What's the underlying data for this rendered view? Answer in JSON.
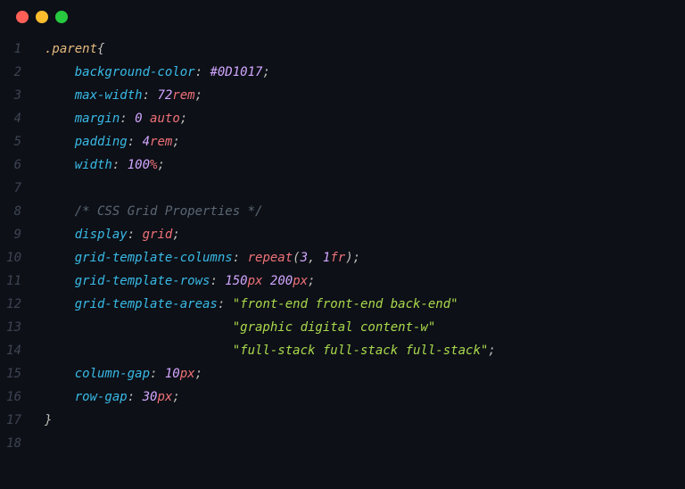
{
  "trafficLights": [
    "red",
    "yellow",
    "green"
  ],
  "lines": [
    {
      "n": 1,
      "tokens": [
        {
          "t": ".parent",
          "c": "selector"
        },
        {
          "t": "{",
          "c": "punc"
        }
      ]
    },
    {
      "n": 2,
      "tokens": [
        {
          "t": "    ",
          "c": "punc"
        },
        {
          "t": "background-color",
          "c": "prop"
        },
        {
          "t": ": ",
          "c": "punc"
        },
        {
          "t": "#0D1017",
          "c": "number"
        },
        {
          "t": ";",
          "c": "punc"
        }
      ]
    },
    {
      "n": 3,
      "tokens": [
        {
          "t": "    ",
          "c": "punc"
        },
        {
          "t": "max-width",
          "c": "prop"
        },
        {
          "t": ": ",
          "c": "punc"
        },
        {
          "t": "72",
          "c": "number"
        },
        {
          "t": "rem",
          "c": "unit"
        },
        {
          "t": ";",
          "c": "punc"
        }
      ]
    },
    {
      "n": 4,
      "tokens": [
        {
          "t": "    ",
          "c": "punc"
        },
        {
          "t": "margin",
          "c": "prop"
        },
        {
          "t": ": ",
          "c": "punc"
        },
        {
          "t": "0",
          "c": "number"
        },
        {
          "t": " ",
          "c": "punc"
        },
        {
          "t": "auto",
          "c": "value-ident"
        },
        {
          "t": ";",
          "c": "punc"
        }
      ]
    },
    {
      "n": 5,
      "tokens": [
        {
          "t": "    ",
          "c": "punc"
        },
        {
          "t": "padding",
          "c": "prop"
        },
        {
          "t": ": ",
          "c": "punc"
        },
        {
          "t": "4",
          "c": "number"
        },
        {
          "t": "rem",
          "c": "unit"
        },
        {
          "t": ";",
          "c": "punc"
        }
      ]
    },
    {
      "n": 6,
      "tokens": [
        {
          "t": "    ",
          "c": "punc"
        },
        {
          "t": "width",
          "c": "prop"
        },
        {
          "t": ": ",
          "c": "punc"
        },
        {
          "t": "100",
          "c": "number"
        },
        {
          "t": "%",
          "c": "unit upright"
        },
        {
          "t": ";",
          "c": "punc"
        }
      ]
    },
    {
      "n": 7,
      "tokens": []
    },
    {
      "n": 8,
      "tokens": [
        {
          "t": "    ",
          "c": "punc"
        },
        {
          "t": "/* CSS Grid Properties */",
          "c": "comment"
        }
      ]
    },
    {
      "n": 9,
      "tokens": [
        {
          "t": "    ",
          "c": "punc"
        },
        {
          "t": "display",
          "c": "prop"
        },
        {
          "t": ": ",
          "c": "punc"
        },
        {
          "t": "grid",
          "c": "value-ident"
        },
        {
          "t": ";",
          "c": "punc"
        }
      ]
    },
    {
      "n": 10,
      "tokens": [
        {
          "t": "    ",
          "c": "punc"
        },
        {
          "t": "grid-template-columns",
          "c": "prop"
        },
        {
          "t": ": ",
          "c": "punc"
        },
        {
          "t": "repeat",
          "c": "func"
        },
        {
          "t": "(",
          "c": "punc"
        },
        {
          "t": "3",
          "c": "number"
        },
        {
          "t": ", ",
          "c": "punc"
        },
        {
          "t": "1",
          "c": "number"
        },
        {
          "t": "fr",
          "c": "unit"
        },
        {
          "t": ")",
          "c": "punc"
        },
        {
          "t": ";",
          "c": "punc"
        }
      ]
    },
    {
      "n": 11,
      "tokens": [
        {
          "t": "    ",
          "c": "punc"
        },
        {
          "t": "grid-template-rows",
          "c": "prop"
        },
        {
          "t": ": ",
          "c": "punc"
        },
        {
          "t": "150",
          "c": "number"
        },
        {
          "t": "px",
          "c": "unit"
        },
        {
          "t": " ",
          "c": "punc"
        },
        {
          "t": "200",
          "c": "number"
        },
        {
          "t": "px",
          "c": "unit"
        },
        {
          "t": ";",
          "c": "punc"
        }
      ]
    },
    {
      "n": 12,
      "tokens": [
        {
          "t": "    ",
          "c": "punc"
        },
        {
          "t": "grid-template-areas",
          "c": "prop"
        },
        {
          "t": ": ",
          "c": "punc"
        },
        {
          "t": "\"front-end front-end back-end\"",
          "c": "string"
        }
      ]
    },
    {
      "n": 13,
      "tokens": [
        {
          "t": "                         ",
          "c": "punc"
        },
        {
          "t": "\"graphic digital content-w\"",
          "c": "string"
        }
      ]
    },
    {
      "n": 14,
      "tokens": [
        {
          "t": "                         ",
          "c": "punc"
        },
        {
          "t": "\"full-stack full-stack full-stack\"",
          "c": "string"
        },
        {
          "t": ";",
          "c": "punc"
        }
      ]
    },
    {
      "n": 15,
      "tokens": [
        {
          "t": "    ",
          "c": "punc"
        },
        {
          "t": "column-gap",
          "c": "prop"
        },
        {
          "t": ": ",
          "c": "punc"
        },
        {
          "t": "10",
          "c": "number"
        },
        {
          "t": "px",
          "c": "unit"
        },
        {
          "t": ";",
          "c": "punc"
        }
      ]
    },
    {
      "n": 16,
      "tokens": [
        {
          "t": "    ",
          "c": "punc"
        },
        {
          "t": "row-gap",
          "c": "prop"
        },
        {
          "t": ": ",
          "c": "punc"
        },
        {
          "t": "30",
          "c": "number"
        },
        {
          "t": "px",
          "c": "unit"
        },
        {
          "t": ";",
          "c": "punc"
        }
      ]
    },
    {
      "n": 17,
      "tokens": [
        {
          "t": "}",
          "c": "punc"
        }
      ]
    },
    {
      "n": 18,
      "tokens": []
    }
  ]
}
